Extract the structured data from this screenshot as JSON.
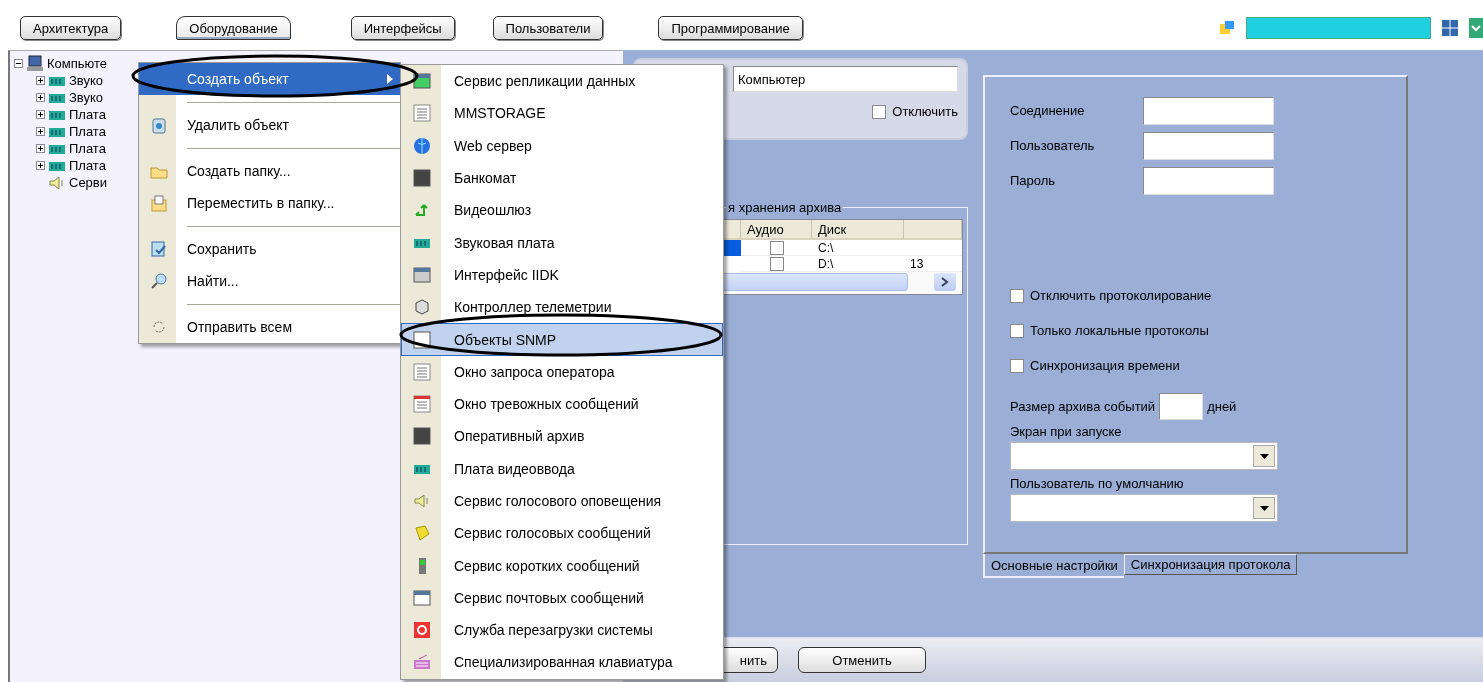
{
  "toolbar": {
    "tabs": [
      {
        "label": "Архитектура",
        "selected": false
      },
      {
        "label": "Оборудование",
        "selected": true
      },
      {
        "label": "Интерфейсы",
        "selected": false
      },
      {
        "label": "Пользователи",
        "selected": false
      },
      {
        "label": "Программирование",
        "selected": false
      }
    ]
  },
  "tree": {
    "items": [
      {
        "label": "Компьюте",
        "expanded": true,
        "children": [
          {
            "label": "Звуко",
            "expanded": false
          },
          {
            "label": "Звуко",
            "expanded": false
          },
          {
            "label": "Плата",
            "expanded": false
          },
          {
            "label": "Плата",
            "expanded": false
          },
          {
            "label": "Плата",
            "expanded": false
          },
          {
            "label": "Плата",
            "expanded": false
          },
          {
            "label": "Серви"
          }
        ]
      }
    ]
  },
  "object_panel": {
    "name_field": {
      "value": "Компьютер"
    },
    "disable_checkbox": {
      "label": "Отключить",
      "checked": false
    }
  },
  "archive_group": {
    "title": "я хранения архива",
    "table": {
      "columns": [
        "Аудио",
        "Диск"
      ],
      "rows": [
        {
          "selected": true,
          "audio": false,
          "disk": "C:\\"
        },
        {
          "selected": false,
          "audio": false,
          "disk": "D:\\",
          "column_5": "13"
        }
      ]
    }
  },
  "settings": {
    "fields": [
      {
        "label": "Соединение"
      },
      {
        "label": "Пользователь"
      },
      {
        "label": "Пароль"
      }
    ],
    "checkboxes": [
      {
        "label": "Отключить протоколирование",
        "checked": false
      },
      {
        "label": "Только локальные протоколы",
        "checked": false
      },
      {
        "label": "Синхронизация времени",
        "checked": false
      }
    ],
    "archive_size": {
      "label": "Размер архива событий",
      "unit": "дней"
    },
    "startup_screen": {
      "label": "Экран при запуске"
    },
    "default_user": {
      "label": "Пользователь по умолчанию"
    },
    "tabs": [
      {
        "label": "Основные настройки",
        "selected": true
      },
      {
        "label": "Синхронизация протокола",
        "selected": false
      }
    ]
  },
  "buttons": [
    "нить",
    "Отменить"
  ],
  "context_menu": {
    "items": [
      {
        "kind": "item",
        "label": "Создать объект",
        "selected": true,
        "submenu": true
      },
      {
        "kind": "separator"
      },
      {
        "kind": "item",
        "label": "Удалить объект",
        "selected": false
      },
      {
        "kind": "separator"
      },
      {
        "kind": "item",
        "label": "Создать папку...",
        "selected": false
      },
      {
        "kind": "item",
        "label": "Переместить в папку...",
        "selected": false
      },
      {
        "kind": "separator"
      },
      {
        "kind": "item",
        "label": "Сохранить",
        "selected": false
      },
      {
        "kind": "item",
        "label": "Найти...",
        "selected": false
      },
      {
        "kind": "separator"
      },
      {
        "kind": "item",
        "label": "Отправить всем",
        "selected": false
      }
    ]
  },
  "submenu": {
    "items": [
      {
        "label": "Сервис репликации данных",
        "selected": false
      },
      {
        "label": "MMSTORAGE",
        "selected": false
      },
      {
        "label": "Web сервер",
        "selected": false
      },
      {
        "label": "Банкомат",
        "selected": false
      },
      {
        "label": "Видеошлюз",
        "selected": false
      },
      {
        "label": "Звуковая плата",
        "selected": false
      },
      {
        "label": "Интерфейс IIDK",
        "selected": false
      },
      {
        "label": "Контроллер телеметрии",
        "selected": false
      },
      {
        "label": "Объекты SNMP",
        "selected": true
      },
      {
        "label": "Окно запроса оператора",
        "selected": false
      },
      {
        "label": "Окно тревожных сообщений",
        "selected": false
      },
      {
        "label": "Оперативный архив",
        "selected": false
      },
      {
        "label": "Плата видеоввода",
        "selected": false
      },
      {
        "label": "Сервис голосового оповещения",
        "selected": false
      },
      {
        "label": "Сервис голосовых сообщений",
        "selected": false
      },
      {
        "label": "Сервис коротких сообщений",
        "selected": false
      },
      {
        "label": "Сервис почтовых сообщений",
        "selected": false
      },
      {
        "label": "Служба перезагрузки системы",
        "selected": false
      },
      {
        "label": "Специализированная клавиатура",
        "selected": false
      }
    ]
  }
}
